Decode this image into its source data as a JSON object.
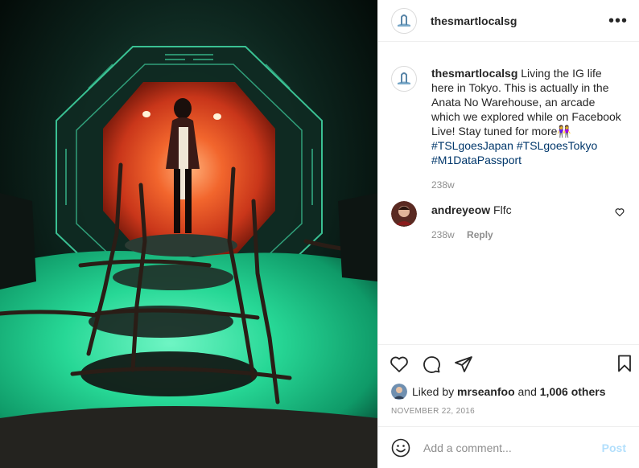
{
  "post": {
    "author": "thesmartlocalsg",
    "caption": {
      "username": "thesmartlocalsg",
      "text": "Living the IG life here in Tokyo. This is actually in the Anata No Warehouse, an arcade which we explored while on Facebook Live! Stay tuned for more",
      "emoji": "👭",
      "hashtags": [
        "#TSLgoesJapan",
        "#TSLgoesTokyo",
        "#M1DataPassport"
      ],
      "age": "238w"
    },
    "comments": [
      {
        "username": "andreyeow",
        "text": "Flfc",
        "age": "238w",
        "reply_label": "Reply"
      }
    ],
    "likes": {
      "prefix": "Liked by",
      "user": "mrseanfoo",
      "connector": "and",
      "others": "1,006 others"
    },
    "date": "NOVEMBER 22, 2016",
    "add_comment": {
      "placeholder": "Add a comment...",
      "post_label": "Post"
    },
    "more_label": "•••",
    "icons": {
      "more": "more-horizontal-icon",
      "like": "heart-icon",
      "comment": "comment-bubble-icon",
      "share": "paper-plane-icon",
      "save": "bookmark-icon",
      "emoji": "smiley-icon"
    },
    "colors": {
      "hashtag": "#00376b",
      "post_button": "#b2dffc",
      "muted": "#8e8e8e",
      "photo_glow_green": "#2fe6a0",
      "photo_portal_orange": "#e8451e"
    }
  }
}
